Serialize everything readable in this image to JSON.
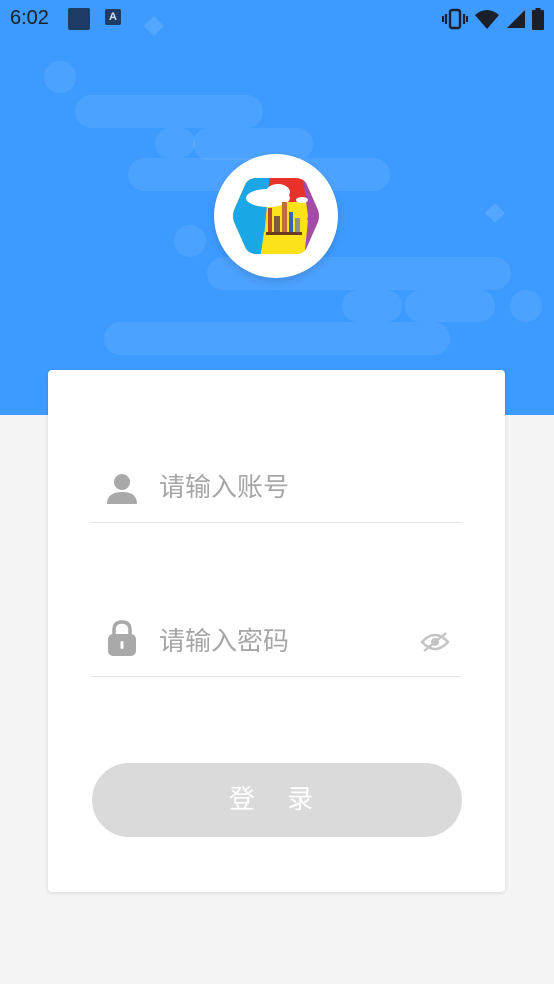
{
  "status_bar": {
    "time": "6:02",
    "notification_letter": "A"
  },
  "colors": {
    "header_blue": "#3d9bff",
    "button_gray": "#dadada",
    "placeholder_gray": "#a6a6a6",
    "icon_gray": "#a9a9a9"
  },
  "icons": {
    "user": "user-icon",
    "lock": "lock-icon",
    "eye": "eye-off-icon",
    "logo": "app-logo"
  },
  "login": {
    "username_placeholder": "请输入账号",
    "username_value": "",
    "password_placeholder": "请输入密码",
    "password_value": "",
    "button_label": "登 录"
  }
}
